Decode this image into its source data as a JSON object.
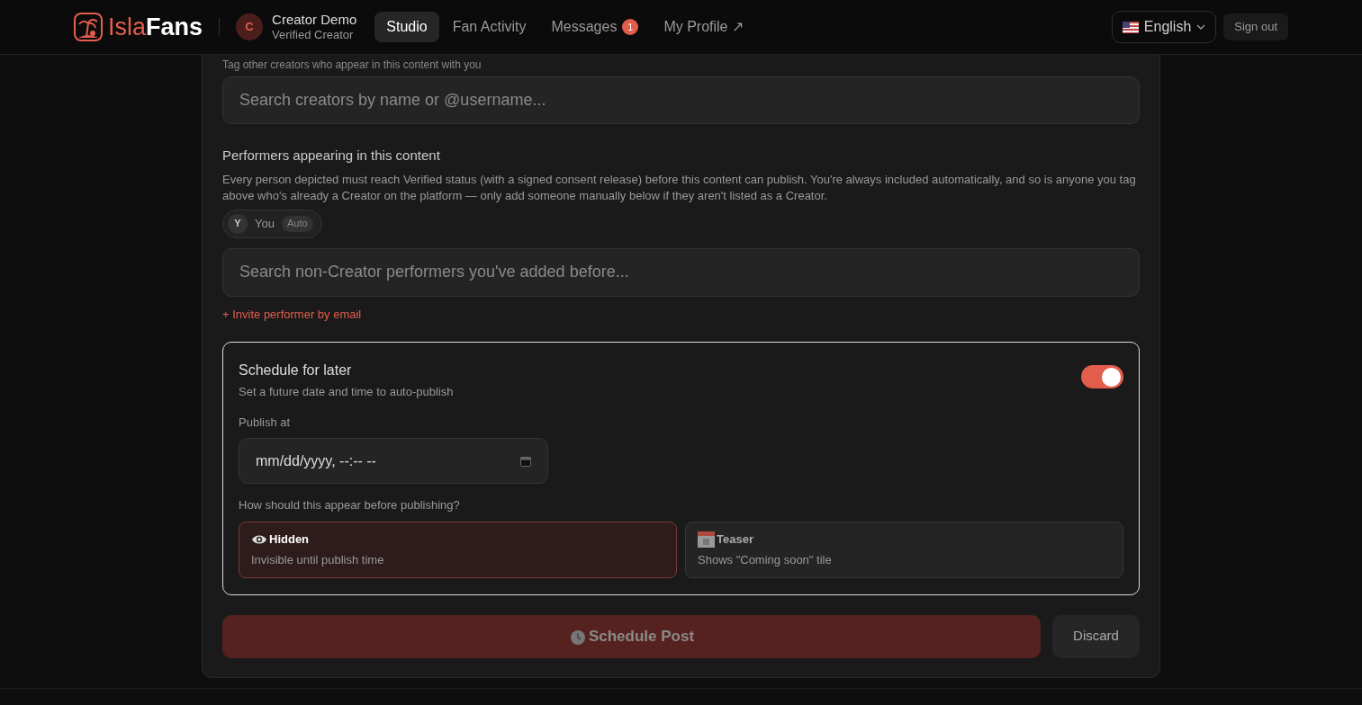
{
  "header": {
    "brand_light": "Isla",
    "brand_bold": "Fans",
    "user": {
      "initial": "C",
      "name": "Creator Demo",
      "role": "Verified Creator"
    },
    "nav": [
      {
        "label": "Studio",
        "selected": true
      },
      {
        "label": "Fan Activity",
        "selected": false
      },
      {
        "label": "Messages",
        "selected": false,
        "badge": "1"
      },
      {
        "label": "My Profile ↗",
        "selected": false
      }
    ],
    "language": "English",
    "sign_out": "Sign out"
  },
  "tag_section": {
    "hint": "Tag other creators who appear in this content with you",
    "placeholder": "Search creators by name or @username..."
  },
  "performers": {
    "title": "Performers appearing in this content",
    "description": "Every person depicted must reach Verified status (with a signed consent release) before this content can publish. You're always included automatically, and so is anyone you tag above who's already a Creator on the platform — only add someone manually below if they aren't listed as a Creator.",
    "chips": [
      {
        "initial": "Y",
        "name": "You",
        "tag": "Auto"
      }
    ],
    "placeholder": "Search non-Creator performers you've added before...",
    "invite": "+ Invite performer by email"
  },
  "schedule": {
    "title": "Schedule for later",
    "subtitle": "Set a future date and time to auto-publish",
    "on": true,
    "publish_label": "Publish at",
    "date_placeholder": "mm/dd/yyyy, --:-- --",
    "question": "How should this appear before publishing?",
    "options": [
      {
        "kind": "hidden",
        "title": "Hidden",
        "description": "Invisible until publish time",
        "selected": true
      },
      {
        "kind": "teaser",
        "title": "Teaser",
        "description": "Shows \"Coming soon\" tile",
        "selected": false
      }
    ]
  },
  "actions": {
    "primary": "Schedule Post",
    "primary_disabled": true,
    "secondary": "Discard"
  }
}
